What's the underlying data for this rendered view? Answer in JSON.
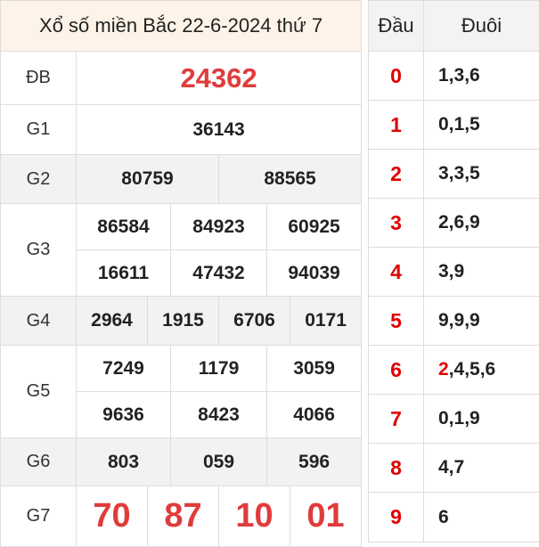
{
  "title": "Xổ số miền Bắc 22-6-2024 thứ 7",
  "prizes": {
    "db": {
      "label": "ĐB",
      "values": [
        "24362"
      ]
    },
    "g1": {
      "label": "G1",
      "values": [
        "36143"
      ]
    },
    "g2": {
      "label": "G2",
      "values": [
        "80759",
        "88565"
      ]
    },
    "g3": {
      "label": "G3",
      "values": [
        "86584",
        "84923",
        "60925",
        "16611",
        "47432",
        "94039"
      ]
    },
    "g4": {
      "label": "G4",
      "values": [
        "2964",
        "1915",
        "6706",
        "0171"
      ]
    },
    "g5": {
      "label": "G5",
      "values": [
        "7249",
        "1179",
        "3059",
        "9636",
        "8423",
        "4066"
      ]
    },
    "g6": {
      "label": "G6",
      "values": [
        "803",
        "059",
        "596"
      ]
    },
    "g7": {
      "label": "G7",
      "values": [
        "70",
        "87",
        "10",
        "01"
      ]
    }
  },
  "loto": {
    "head_label": "Đầu",
    "tail_label": "Đuôi",
    "rows": [
      {
        "head": "0",
        "tail": "1,3,6"
      },
      {
        "head": "1",
        "tail": "0,1,5"
      },
      {
        "head": "2",
        "tail": "3,3,5"
      },
      {
        "head": "3",
        "tail": "2,6,9"
      },
      {
        "head": "4",
        "tail": "3,9"
      },
      {
        "head": "5",
        "tail": "9,9,9"
      },
      {
        "head": "6",
        "tail_special": "2",
        "tail_rest": ",4,5,6"
      },
      {
        "head": "7",
        "tail": "0,1,9"
      },
      {
        "head": "8",
        "tail": "4,7"
      },
      {
        "head": "9",
        "tail": "6"
      }
    ]
  },
  "colors": {
    "accent": "#e03c3c",
    "header_bg": "#fef3e8",
    "alt_row": "#f2f2f2"
  }
}
